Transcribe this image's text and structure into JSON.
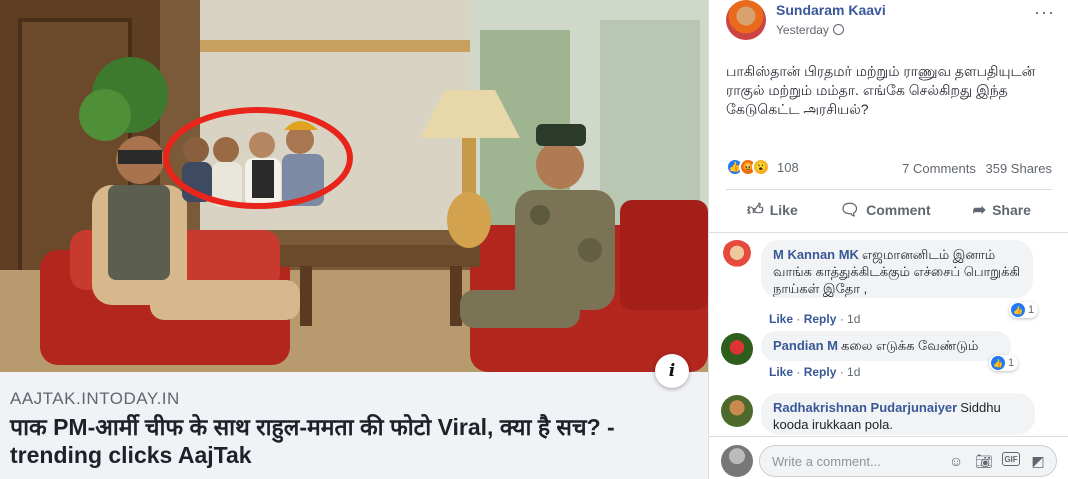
{
  "link_preview": {
    "domain": "AAJTAK.INTODAY.IN",
    "headline": "पाक PM-आर्मी चीफ के साथ राहुल-ममता की फोटो Viral, क्या है सच? - trending clicks AajTak",
    "info_label": "i"
  },
  "post": {
    "author": "Sundaram Kaavi",
    "time": "Yesterday",
    "more_label": "···",
    "text": "பாகிஸ்தான் பிரதமர் மற்றும் ராணுவ தளபதியுடன் ராகுல் மற்றும் மம்தா. எங்கே செல்கிறது இந்த கேடுகெட்ட அரசியல்?",
    "reaction_count": "108",
    "comments_count": "7 Comments",
    "shares_count": "359 Shares",
    "actions": [
      {
        "label": "Like",
        "icon": "thumbs-up-icon"
      },
      {
        "label": "Comment",
        "icon": "comment-icon"
      },
      {
        "label": "Share",
        "icon": "share-icon"
      }
    ]
  },
  "comments": [
    {
      "name": "M Kannan MK",
      "text": "எஜமானனிடம் இனாம் வாங்க காத்துக்கிடக்கும் எச்சைப் பொறுக்கி நாய்கள் இதோ ,",
      "reactions": "1",
      "like": "Like",
      "reply": "Reply",
      "time": "1d"
    },
    {
      "name": "Pandian M",
      "text": "கலை எடுக்க வேண்டும்",
      "reactions": "1",
      "like": "Like",
      "reply": "Reply",
      "time": "1d"
    },
    {
      "name": "Radhakrishnan Pudarjunaiyer",
      "text": "Siddhu kooda irukkaan pola."
    }
  ],
  "composer": {
    "placeholder": "Write a comment..."
  },
  "colors": {
    "link_blue": "#385898",
    "like_blue": "#2078f4",
    "angry_orange": "#e9710f",
    "wow_yellow": "#f7b125"
  }
}
